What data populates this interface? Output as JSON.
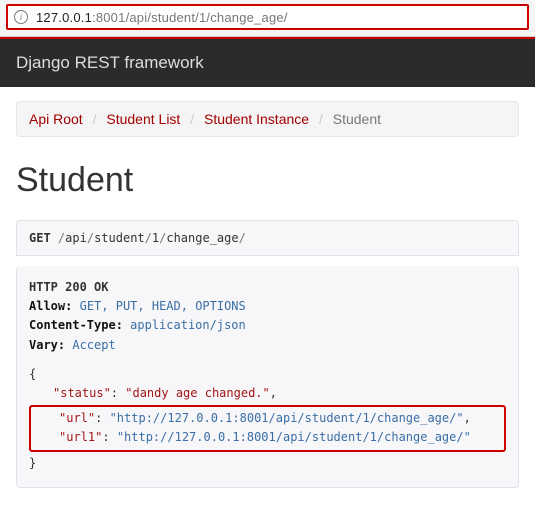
{
  "browser": {
    "url_host": "127.0.0.1",
    "url_port": ":8001",
    "url_path": "/api/student/1/change_age/"
  },
  "header": {
    "brand": "Django REST framework"
  },
  "breadcrumb": {
    "items": [
      {
        "label": "Api Root"
      },
      {
        "label": "Student List"
      },
      {
        "label": "Student Instance"
      }
    ],
    "active": "Student"
  },
  "page": {
    "title": "Student"
  },
  "request": {
    "method": "GET",
    "path_segments": [
      "api",
      "student",
      "1",
      "change_age"
    ]
  },
  "response": {
    "status_line": "HTTP 200 OK",
    "headers": {
      "allow_label": "Allow:",
      "allow_value": "GET, PUT, HEAD, OPTIONS",
      "ctype_label": "Content-Type:",
      "ctype_value": "application/json",
      "vary_label": "Vary:",
      "vary_value": "Accept"
    },
    "body": {
      "status_key": "\"status\"",
      "status_val": "\"dandy age changed.\"",
      "url_key": "\"url\"",
      "url_val": "\"http://127.0.0.1:8001/api/student/1/change_age/\"",
      "url1_key": "\"url1\"",
      "url1_val": "\"http://127.0.0.1:8001/api/student/1/change_age/\""
    }
  }
}
